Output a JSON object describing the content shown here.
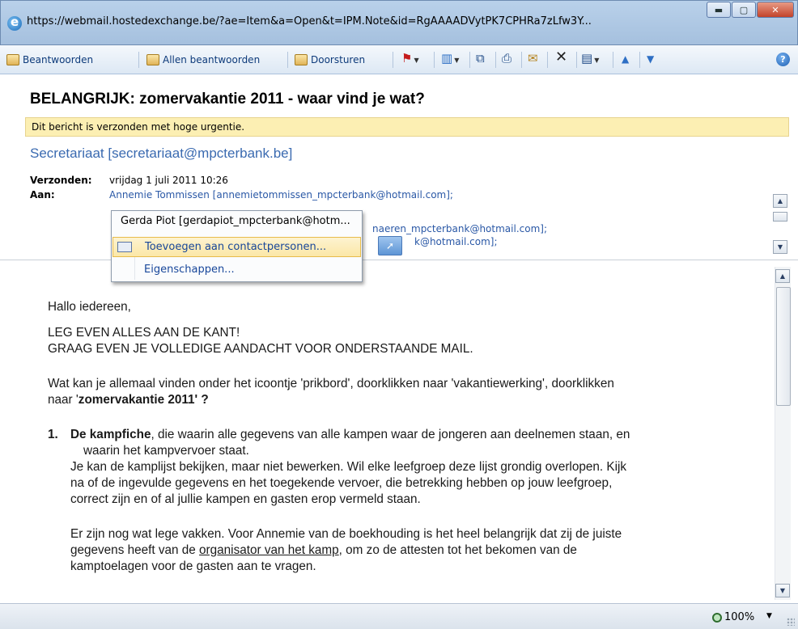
{
  "window": {
    "url": "https://webmail.hostedexchange.be/?ae=Item&a=Open&t=IPM.Note&id=RgAAAADVytPK7CPHRa7zLfw3Y..."
  },
  "toolbar": {
    "reply": "Beantwoorden",
    "reply_all": "Allen beantwoorden",
    "forward": "Doorsturen"
  },
  "message": {
    "subject": "BELANGRIJK: zomervakantie 2011 - waar vind je wat?",
    "urgency_notice": "Dit bericht is verzonden met hoge urgentie.",
    "sender": "Secretariaat [secretariaat@mpcterbank.be]",
    "sent_label": "Verzonden:",
    "sent_value": "vrijdag 1 juli 2011 10:26",
    "to_label": "Aan:",
    "recipients": [
      "Annemie Tommissen [annemietommissen_mpcterbank@hotmail.com];",
      "naeren_mpcterbank@hotmail.com];",
      "k@hotmail.com];"
    ]
  },
  "context_menu": {
    "header": "Gerda Piot [gerdapiot_mpcterbank@hotm...",
    "items": [
      "Toevoegen aan contactpersonen...",
      "Eigenschappen..."
    ]
  },
  "body": {
    "greeting": "Hallo iedereen,",
    "line1": "LEG EVEN ALLES AAN DE KANT!",
    "line2": "GRAAG EVEN JE VOLLEDIGE AANDACHT VOOR ONDERSTAANDE MAIL.",
    "para1_a": "Wat kan je allemaal vinden onder het  icoontje 'prikbord', doorklikken naar 'vakantiewerking', doorklikken",
    "para1_b_pre": "naar '",
    "para1_b_bold": "zomervakantie 2011",
    "para1_b_post": "' ?",
    "item1_num": "1.",
    "item1_bold": "De kampfiche",
    "item1_a": ", die waarin alle gegevens van alle kampen waar de jongeren aan deelnemen staan, en",
    "item1_b": "waarin het kampvervoer staat.",
    "item1_c": "Je kan de kamplijst bekijken, maar niet bewerken. Wil elke leefgroep deze lijst grondig overlopen. Kijk",
    "item1_d": "na of de ingevulde gegevens en het toegekende vervoer, die betrekking hebben op jouw leefgroep,",
    "item1_e": "correct zijn en of al jullie kampen en gasten erop vermeld staan.",
    "item1_f": "Er zijn nog wat lege vakken. Voor Annemie van de boekhouding is het heel belangrijk dat zij de juiste",
    "item1_g_pre": "gegevens heeft van de ",
    "item1_g_link": "organisator van het kamp",
    "item1_g_post": ", om zo de attesten tot het bekomen van de",
    "item1_h": "kamptoelagen voor de gasten aan te vragen."
  },
  "status": {
    "zoom": "100%"
  }
}
